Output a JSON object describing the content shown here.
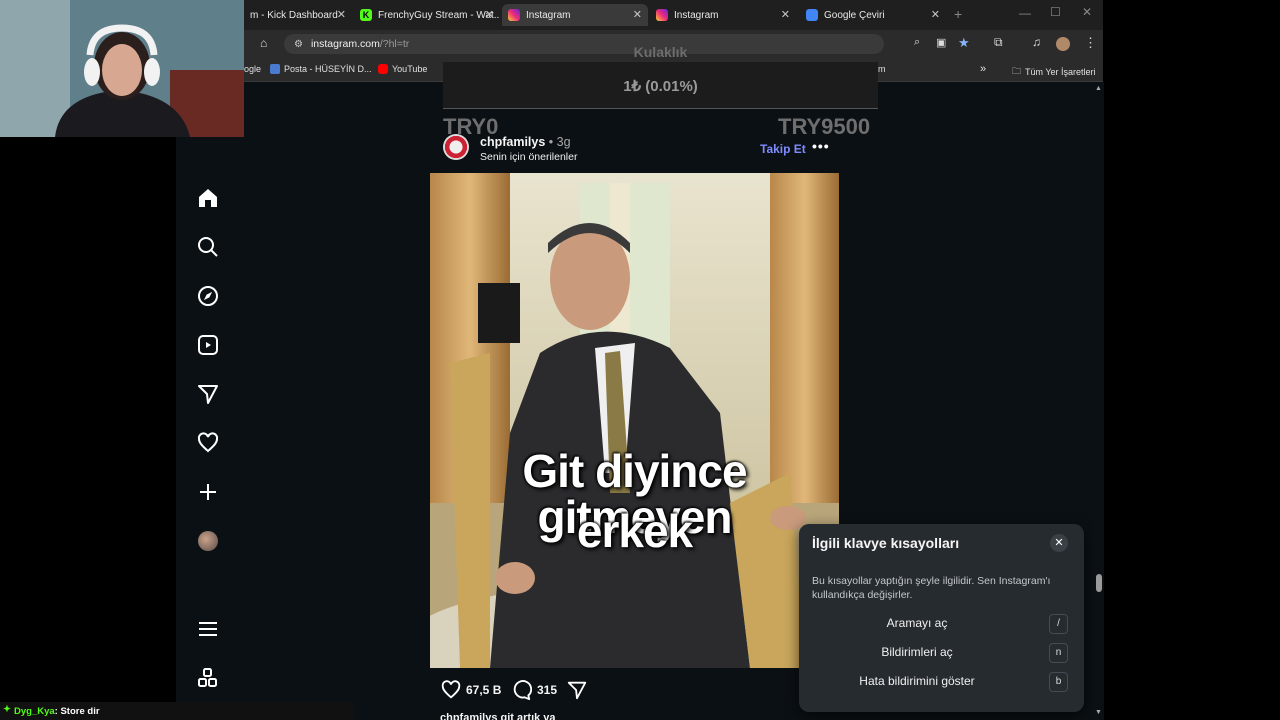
{
  "browser": {
    "tabs": [
      {
        "title": "m - Kick Dashboard",
        "icon_color": "#53fc18",
        "active": false
      },
      {
        "title": "FrenchyGuy Stream - Wat...",
        "icon_color": "#53fc18",
        "active": false
      },
      {
        "title": "Instagram",
        "icon_color": "#e1306c",
        "active": true
      },
      {
        "title": "Instagram",
        "icon_color": "#e1306c",
        "active": false
      },
      {
        "title": "Google Çeviri",
        "icon_color": "#4285f4",
        "active": false
      }
    ],
    "url_domain": "instagram.com",
    "url_path": "/?hl=tr",
    "bookmarks": [
      {
        "label": "ogle"
      },
      {
        "label": "Posta - HÜSEYİN D..."
      },
      {
        "label": "YouTube"
      },
      {
        "label": "m"
      }
    ],
    "all_bookmarks_label": "Tüm Yer İşaretleri"
  },
  "donation_overlay": {
    "title": "Kulaklık",
    "amount": "1₺ (0.01%)",
    "min_label": "TRY0",
    "max_label": "TRY9500"
  },
  "post": {
    "username": "chpfamilys",
    "time": "• 3g",
    "subtitle": "Senin için önerilenler",
    "follow_label": "Takip Et",
    "caption_line1": "Git diyince gitmeyen",
    "caption_line2": "erkek",
    "likes": "67,5 B",
    "comments": "315",
    "caption_preview": "chpfamilys git artık ya"
  },
  "shortcuts_popup": {
    "title": "İlgili klavye kısayolları",
    "description": "Bu kısayollar yaptığın şeyle ilgilidir. Sen Instagram'ı kullandıkça değişirler.",
    "items": [
      {
        "label": "Aramayı aç",
        "key": "/"
      },
      {
        "label": "Bildirimleri aç",
        "key": "n"
      },
      {
        "label": "Hata bildirimini göster",
        "key": "b"
      }
    ]
  },
  "chat": {
    "user": "Dyg_Kya",
    "message": ": Store dir"
  },
  "colors": {
    "accent_link": "#7f8cff",
    "bg": "#0b1014",
    "popup_bg": "#262b30"
  }
}
